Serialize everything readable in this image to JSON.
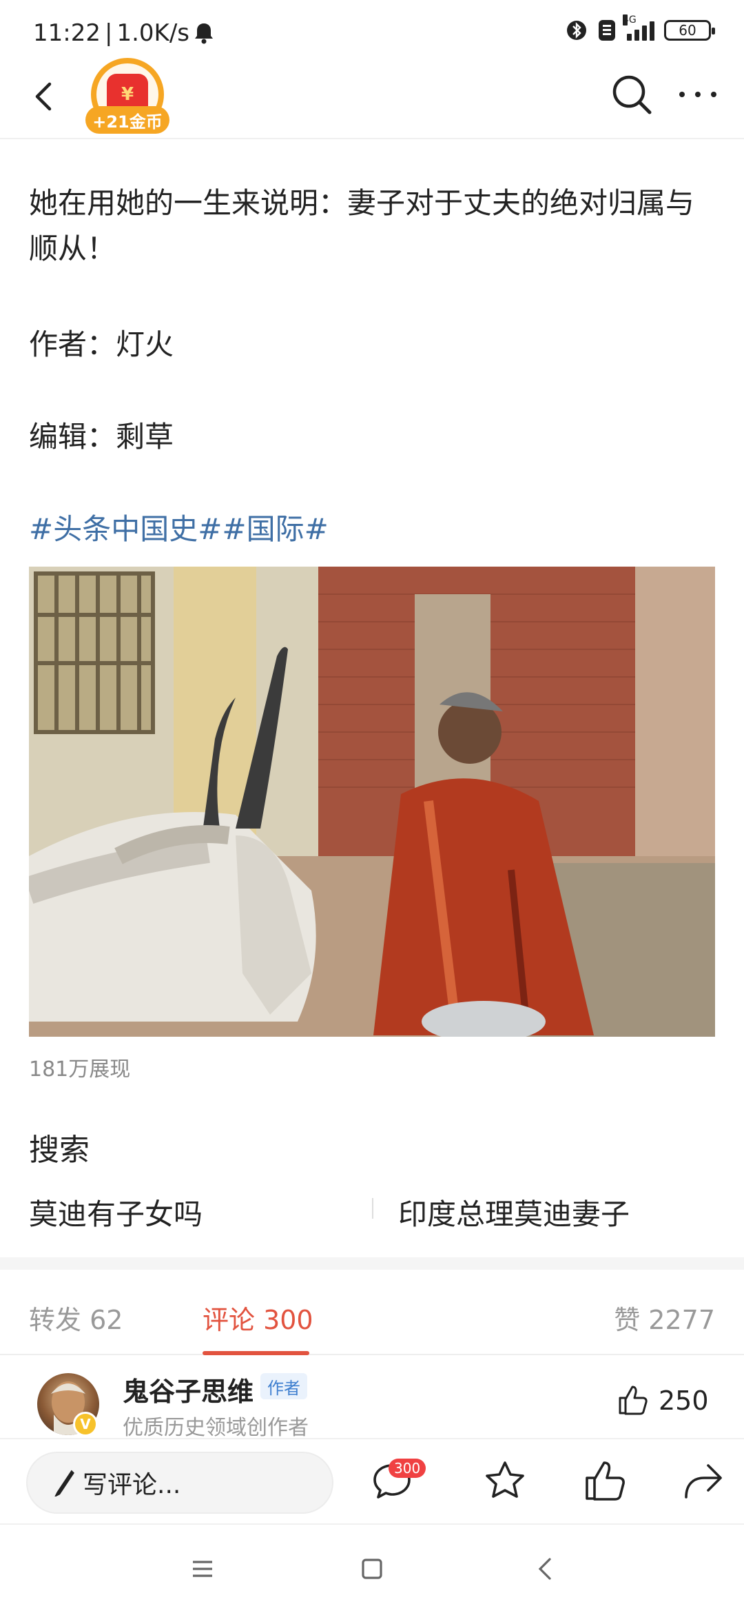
{
  "status_bar": {
    "time": "11:22",
    "speed": "1.0K/s",
    "network": "4G",
    "battery": "60"
  },
  "header": {
    "coin_reward": "+21金币",
    "coin_symbol": "¥"
  },
  "article": {
    "text": "她在用她的一生来说明：妻子对于丈夫的绝对归属与顺从！",
    "author": "作者：灯火",
    "editor": "编辑：剩草",
    "hashtags": "#头条中国史##国际#",
    "views": "181万展现"
  },
  "search": {
    "title": "搜索",
    "suggestions": [
      "莫迪有子女吗",
      "印度总理莫迪妻子"
    ]
  },
  "tabs": {
    "forward": "转发 62",
    "comments": "评论 300",
    "likes": "赞 2277"
  },
  "comment": {
    "name": "鬼谷子思维",
    "badge": "作者",
    "desc": "优质历史领域创作者",
    "likes": "250"
  },
  "toolbar": {
    "input_placeholder": "写评论...",
    "comment_count": "300"
  },
  "colors": {
    "accent": "#e2533f",
    "hashtag": "#3f6fa5",
    "coin": "#f6a623"
  }
}
